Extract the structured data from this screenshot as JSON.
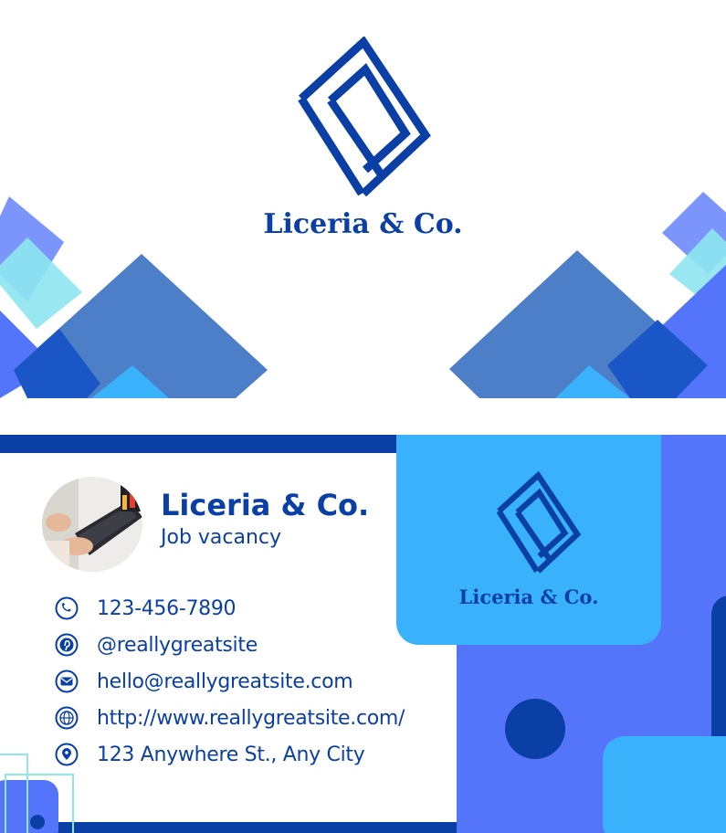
{
  "brand": {
    "name": "Liceria & Co.",
    "tagline": "Job vacancy"
  },
  "colors": {
    "navy": "#0a3fa6",
    "sky": "#3ab2fb",
    "periwinkle": "#5475f9",
    "steel": "#4c7fc7",
    "aqua": "#8ee6ef",
    "white": "#ffffff"
  },
  "front": {
    "logo_icon": "interlocking-s-logo-icon",
    "title": "Liceria & Co."
  },
  "back": {
    "logo_icon": "interlocking-s-logo-icon",
    "title": "Liceria & Co.",
    "photo": "laptop-hands-photo",
    "contacts": [
      {
        "icon": "phone-icon",
        "text": "123-456-7890"
      },
      {
        "icon": "pinterest-icon",
        "text": "@reallygreatsite"
      },
      {
        "icon": "email-icon",
        "text": "hello@reallygreatsite.com"
      },
      {
        "icon": "globe-icon",
        "text": "http://www.reallygreatsite.com/"
      },
      {
        "icon": "location-pin-icon",
        "text": "123 Anywhere St., Any City"
      }
    ]
  }
}
